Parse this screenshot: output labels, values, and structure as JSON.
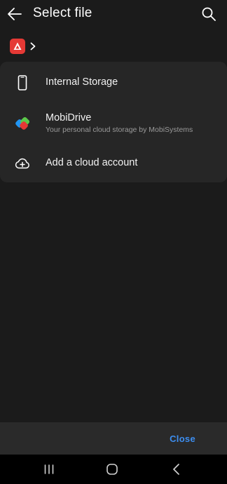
{
  "header": {
    "title": "Select file",
    "back_icon": "arrow-left-icon",
    "search_icon": "search-icon"
  },
  "breadcrumb": {
    "app_icon": "office-suite-logo-icon",
    "chevron_icon": "chevron-right-icon"
  },
  "locations": [
    {
      "label": "Internal Storage",
      "icon": "phone-icon"
    },
    {
      "label": "MobiDrive",
      "subtitle": "Your personal cloud storage by MobiSystems",
      "icon": "mobidrive-logo-icon"
    },
    {
      "label": "Add a cloud account",
      "icon": "cloud-add-icon"
    }
  ],
  "footer": {
    "close_label": "Close"
  },
  "system_nav": {
    "recents_icon": "recents-icon",
    "home_icon": "home-icon",
    "back_icon": "back-icon"
  },
  "colors": {
    "background": "#1b1b1b",
    "sheet": "#262626",
    "accent": "#3d8ef0",
    "logo_red": "#e53935"
  }
}
